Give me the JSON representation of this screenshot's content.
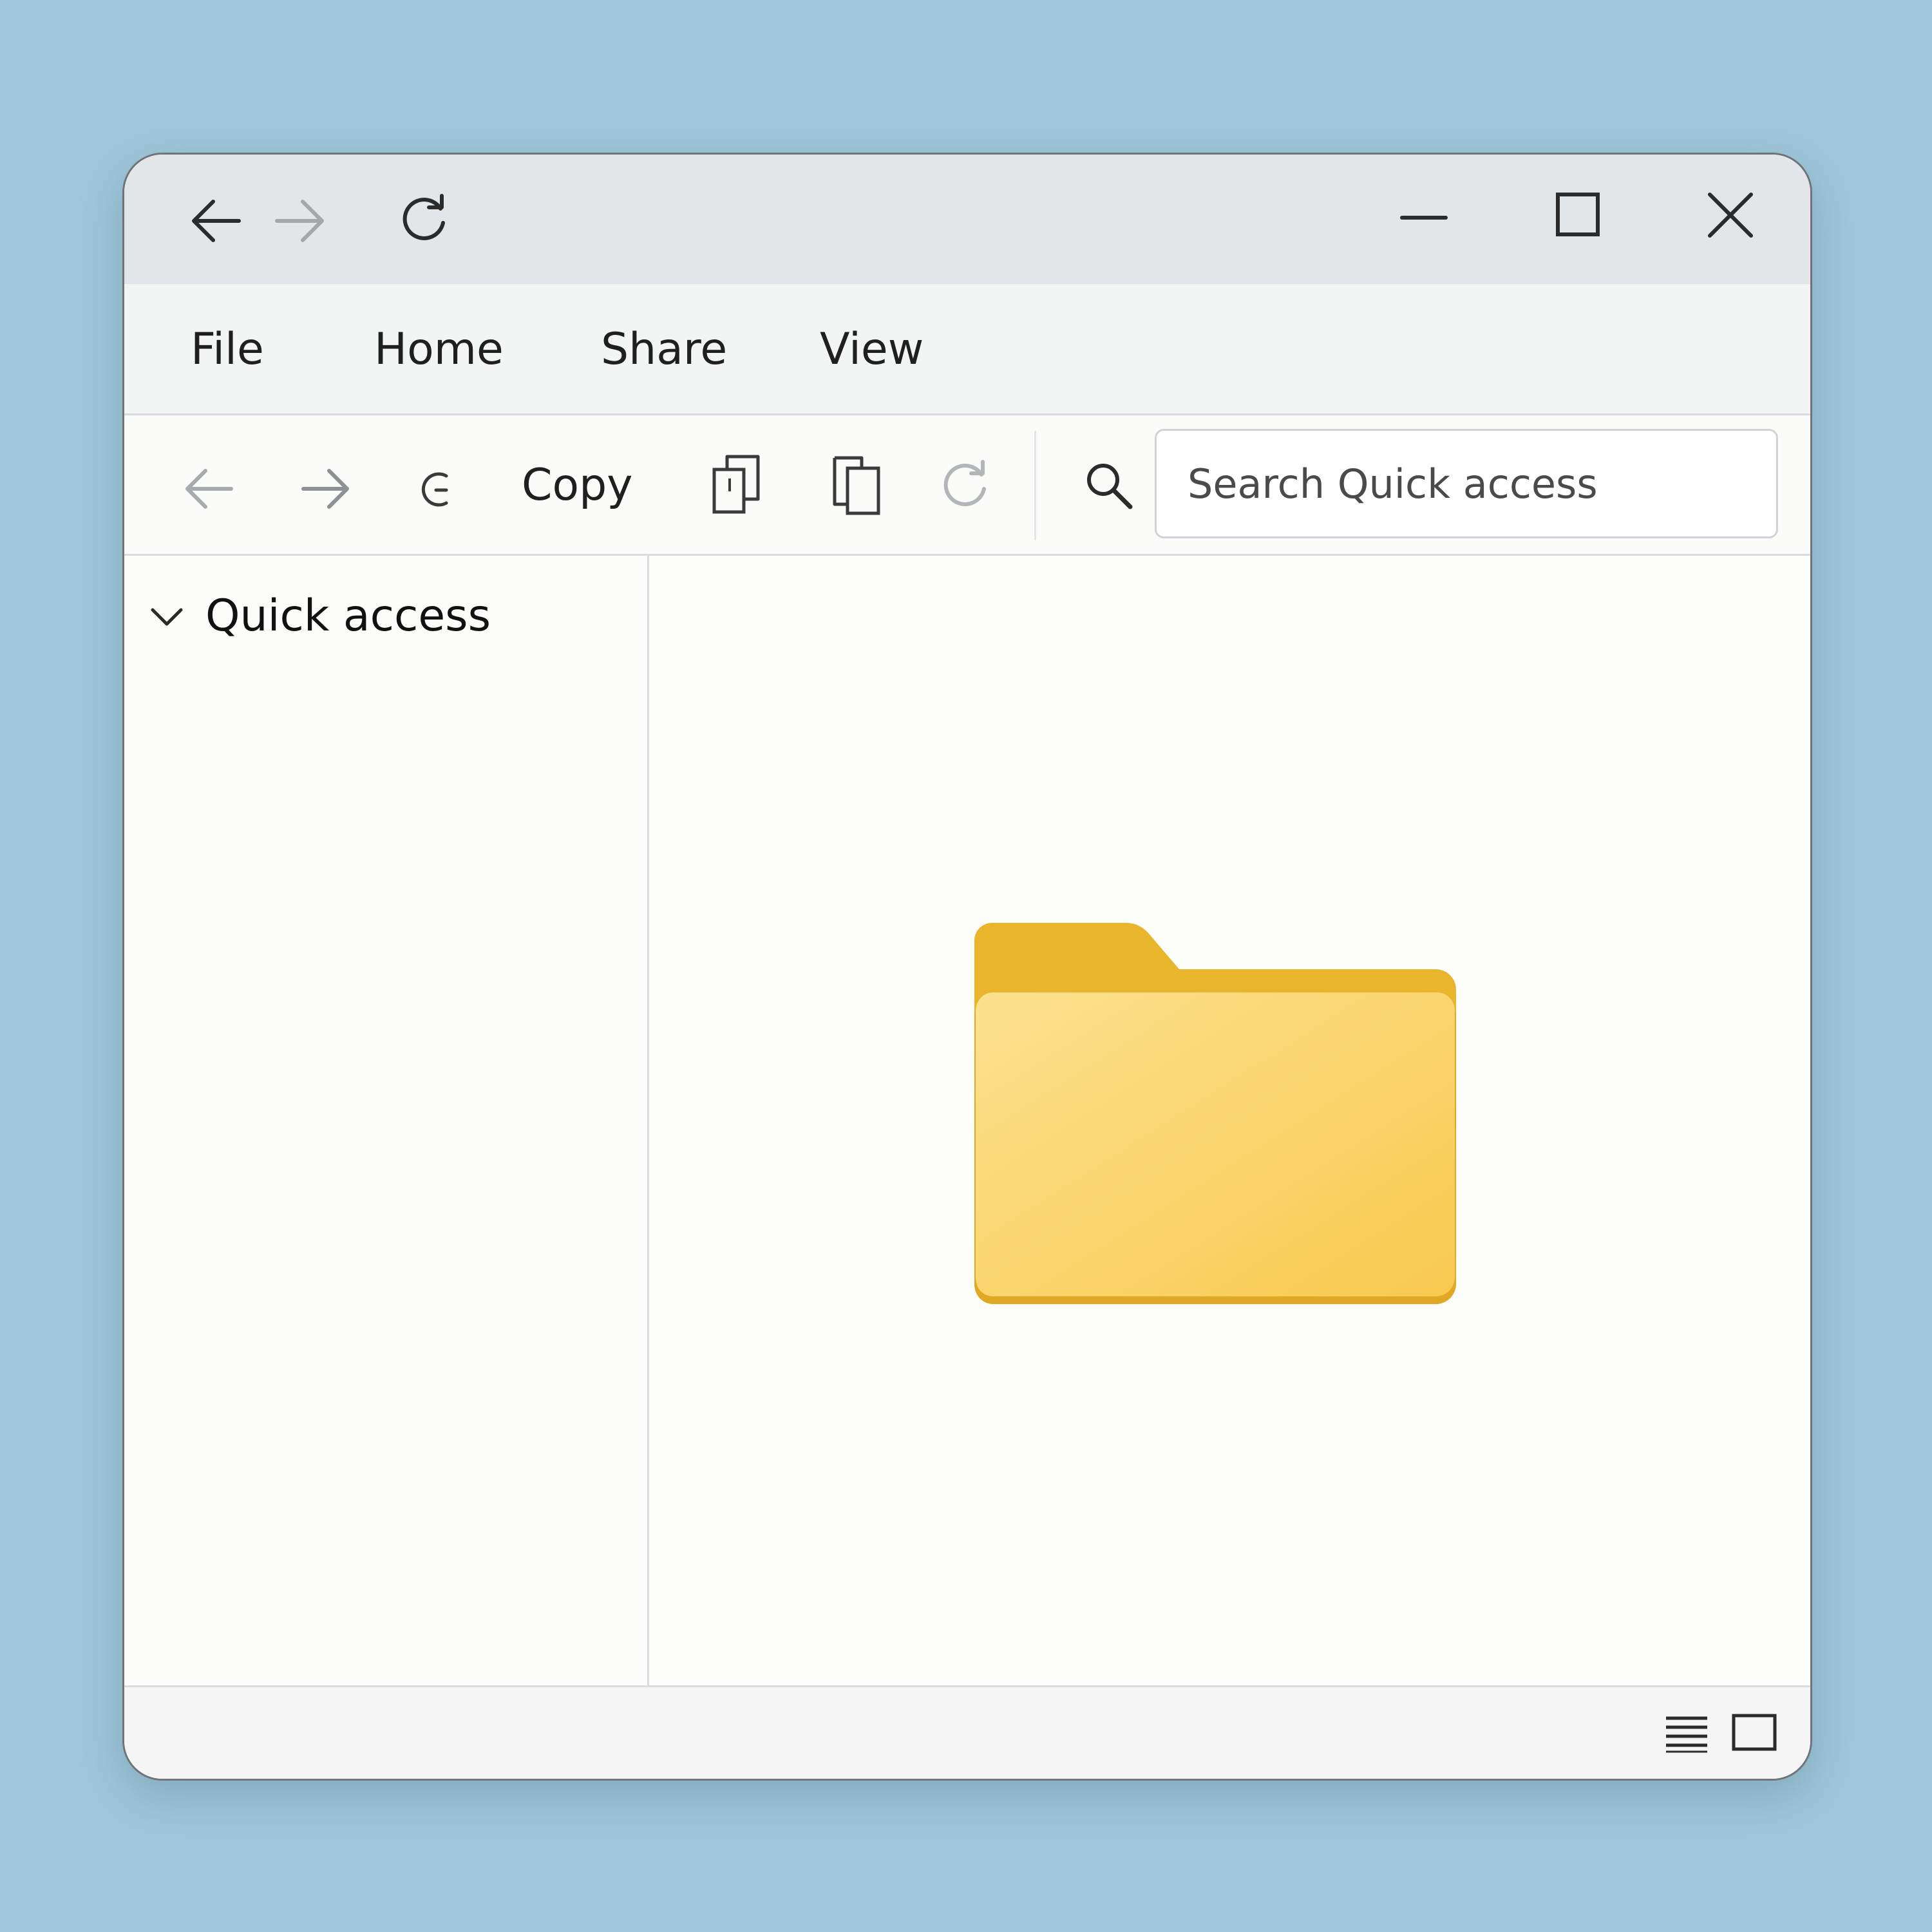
{
  "window": {
    "titlebar": {
      "back_icon": "arrow-left-icon",
      "forward_icon": "arrow-right-icon",
      "refresh_icon": "refresh-icon",
      "minimize_icon": "minimize-icon",
      "maximize_icon": "maximize-icon",
      "close_icon": "close-icon"
    },
    "menu": {
      "items": [
        {
          "label": "File"
        },
        {
          "label": "Home"
        },
        {
          "label": "Share"
        },
        {
          "label": "View"
        }
      ]
    },
    "toolbar": {
      "copy_label": "Copy",
      "search": {
        "placeholder": "Search Quick access",
        "value": ""
      }
    },
    "sidebar": {
      "items": [
        {
          "label": "Quick access",
          "expanded": true
        }
      ]
    },
    "content": {
      "items": [
        {
          "type": "folder",
          "label": ""
        }
      ]
    },
    "statusbar": {
      "view_modes": [
        "details-view-icon",
        "large-icons-view-icon"
      ]
    }
  },
  "colors": {
    "background": "#9fc6d9",
    "titlebar": "#e2e6e9",
    "folder_back": "#e9b52c",
    "folder_front": "#fbd66b"
  }
}
